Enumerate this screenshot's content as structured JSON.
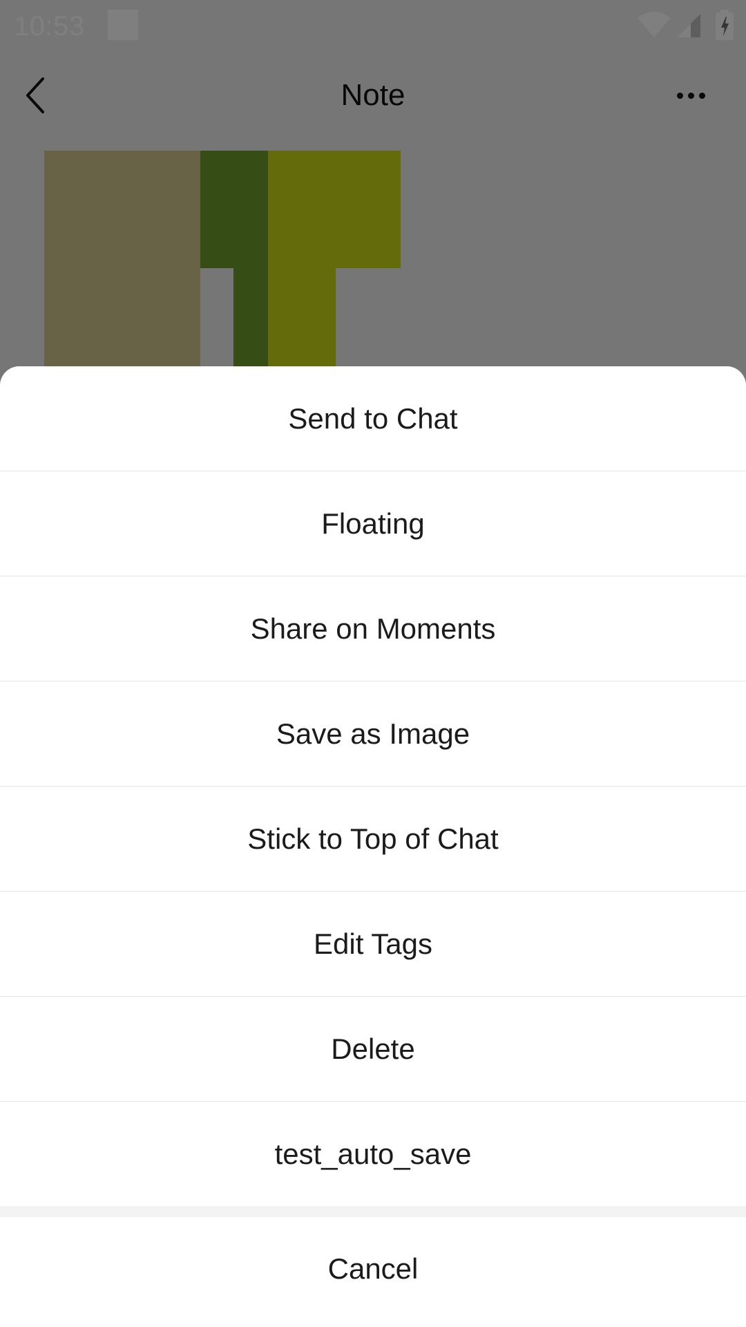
{
  "status_bar": {
    "time": "10:53",
    "icons": [
      "notification-square-icon",
      "wifi-icon",
      "cellular-signal-icon",
      "battery-charging-icon"
    ]
  },
  "app_bar": {
    "title": "Note",
    "back_icon": "chevron-left-icon",
    "more_icon": "more-horizontal-icon"
  },
  "colors": {
    "sheet_background": "#ffffff",
    "overlay": "rgba(0,0,0,0.5)",
    "text": "#1b1b1b",
    "image_tan": "#d0c58f",
    "image_dark_green": "#6f9a2d",
    "image_olive": "#c9d617"
  },
  "action_sheet": {
    "items": [
      "Send to Chat",
      "Floating",
      "Share on Moments",
      "Save as Image",
      "Stick to Top of Chat",
      "Edit Tags",
      "Delete",
      "test_auto_save"
    ],
    "cancel_label": "Cancel"
  }
}
